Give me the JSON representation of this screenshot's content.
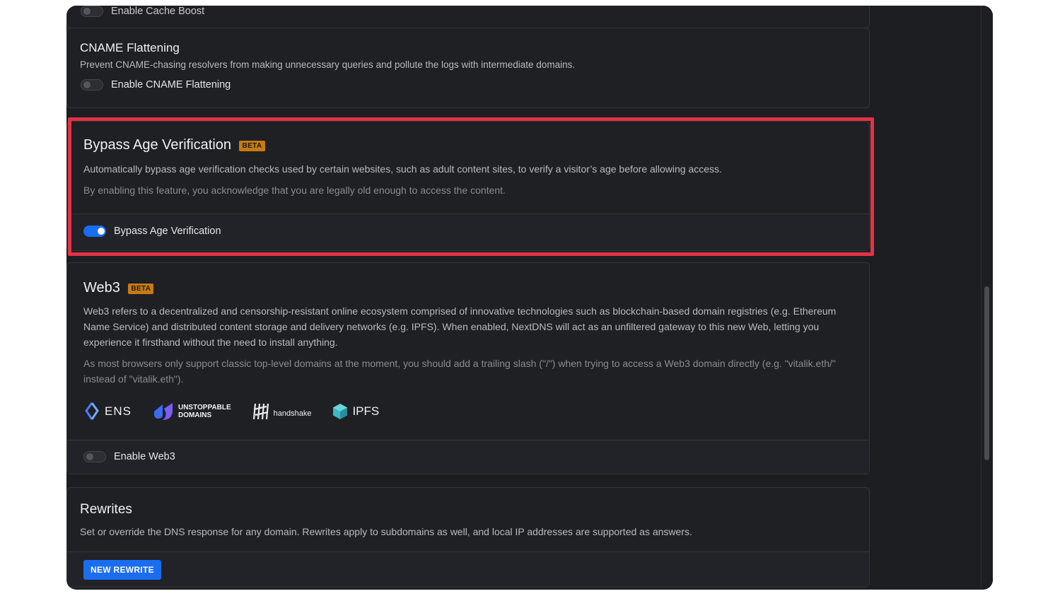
{
  "cache_boost": {
    "toggle_label": "Enable Cache Boost",
    "enabled": false
  },
  "cname": {
    "title": "CNAME Flattening",
    "description": "Prevent CNAME-chasing resolvers from making unnecessary queries and pollute the logs with intermediate domains.",
    "toggle_label": "Enable CNAME Flattening",
    "enabled": false
  },
  "bypass_age": {
    "title": "Bypass Age Verification",
    "badge": "BETA",
    "description": "Automatically bypass age verification checks used by certain websites, such as adult content sites, to verify a visitor’s age before allowing access.",
    "note": "By enabling this feature, you acknowledge that you are legally old enough to access the content.",
    "toggle_label": "Bypass Age Verification",
    "enabled": true,
    "highlight_color": "#e23346"
  },
  "web3": {
    "title": "Web3",
    "badge": "BETA",
    "description": "Web3 refers to a decentralized and censorship-resistant online ecosystem comprised of innovative technologies such as blockchain-based domain registries (e.g. Ethereum Name Service) and distributed content storage and delivery networks (e.g. IPFS). When enabled, NextDNS will act as an unfiltered gateway to this new Web, letting you experience it firsthand without the need to install anything.",
    "note": "As most browsers only support classic top-level domains at the moment, you should add a trailing slash (\"/\") when trying to access a Web3 domain directly (e.g. \"vitalik.eth/\" instead of \"vitalik.eth\").",
    "logos": {
      "ens": "ENS",
      "unstoppable_line1": "UNSTOPPABLE",
      "unstoppable_line2": "DOMAINS",
      "handshake": "handshake",
      "ipfs": "IPFS"
    },
    "toggle_label": "Enable Web3",
    "enabled": false
  },
  "rewrites": {
    "title": "Rewrites",
    "description": "Set or override the DNS response for any domain. Rewrites apply to subdomains as well, and local IP addresses are supported as answers.",
    "button_label": "NEW REWRITE"
  },
  "colors": {
    "accent": "#1a6df0",
    "beta": "#c77a0f",
    "background": "#1d1e22"
  }
}
